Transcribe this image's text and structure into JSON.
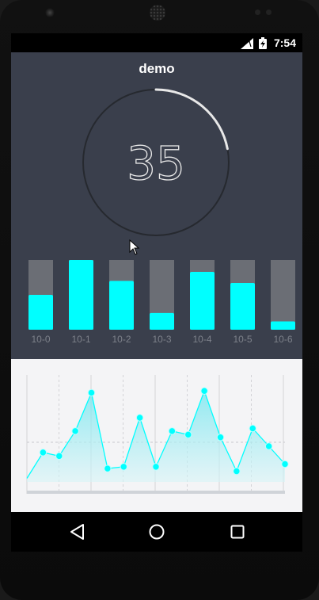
{
  "status_bar": {
    "time": "7:54",
    "battery_icon": "battery-charging-icon",
    "signal_icon": "cell-signal-icon"
  },
  "app": {
    "title": "demo"
  },
  "gauge": {
    "value": 35,
    "display": "35",
    "progress_percent": 22,
    "accent": "#e8e8e8"
  },
  "colors": {
    "accent": "#00ffff",
    "panel": "#3a3f4c",
    "bar_track": "#6b6e75"
  },
  "bar_chart": {
    "type": "bar",
    "categories": [
      "10-0",
      "10-1",
      "10-2",
      "10-3",
      "10-4",
      "10-5",
      "10-6"
    ],
    "values": [
      50,
      100,
      70,
      24,
      83,
      67,
      12
    ],
    "ylim": [
      0,
      100
    ]
  },
  "chart_data": {
    "type": "area",
    "x": [
      0,
      1,
      2,
      3,
      4,
      5,
      6,
      7,
      8,
      9,
      10,
      11,
      12,
      13,
      14,
      15,
      16
    ],
    "values": [
      4,
      33,
      29,
      57,
      100,
      15,
      17,
      72,
      17,
      57,
      53,
      102,
      50,
      12,
      60,
      40,
      20
    ],
    "ylim": [
      0,
      120
    ],
    "grid": true
  },
  "nav_bar": {
    "back_icon": "back-triangle-icon",
    "home_icon": "home-circle-icon",
    "recent_icon": "recent-apps-square-icon"
  }
}
